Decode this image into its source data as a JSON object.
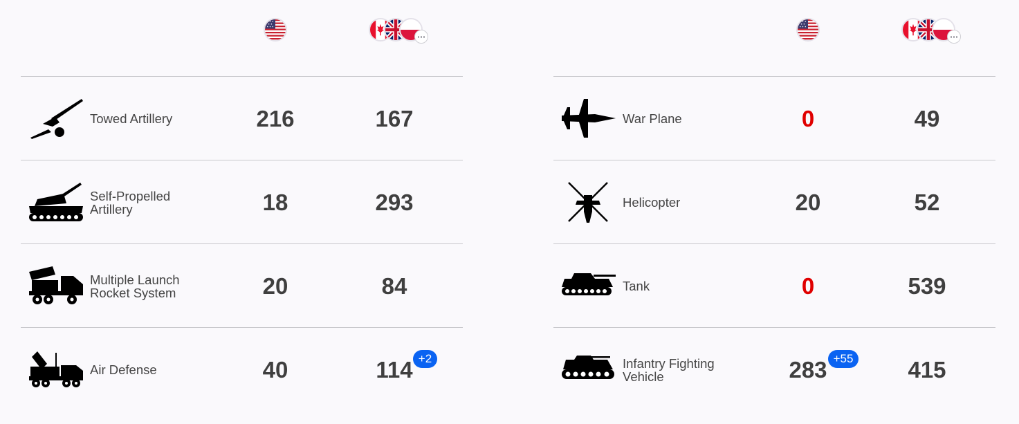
{
  "colors": {
    "zero_value": "#e00000",
    "badge": "#0a63f2",
    "text": "#3f3f3f"
  },
  "left_table": {
    "rows": [
      {
        "label": "Towed Artillery",
        "icon": "towed-artillery-icon",
        "us": "216",
        "allies": "167"
      },
      {
        "label": "Self-Propelled Artillery",
        "icon": "self-propelled-artillery-icon",
        "us": "18",
        "allies": "293"
      },
      {
        "label": "Multiple Launch Rocket System",
        "icon": "rocket-launcher-icon",
        "us": "20",
        "allies": "84"
      },
      {
        "label": "Air Defense",
        "icon": "air-defense-icon",
        "us": "40",
        "allies": "114",
        "allies_badge": "+2"
      }
    ]
  },
  "right_table": {
    "rows": [
      {
        "label": "War Plane",
        "icon": "fighter-jet-icon",
        "us": "0",
        "allies": "49"
      },
      {
        "label": "Helicopter",
        "icon": "helicopter-icon",
        "us": "20",
        "allies": "52"
      },
      {
        "label": "Tank",
        "icon": "tank-icon",
        "us": "0",
        "allies": "539"
      },
      {
        "label": "Infantry Fighting Vehicle",
        "icon": "ifv-icon",
        "us": "283",
        "us_badge": "+55",
        "allies": "415"
      }
    ]
  }
}
